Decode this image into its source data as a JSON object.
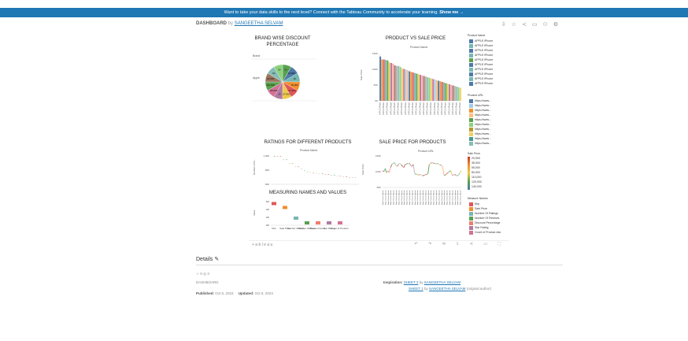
{
  "banner": {
    "text": "Want to take your data skills to the next level? Connect with the Tableau Community to accelerate your learning.",
    "link": "Show me →"
  },
  "header": {
    "title": "DASHBOARD",
    "by": "by",
    "author": "SANGEETHA SELVAM"
  },
  "header_icons": [
    "download-icon",
    "star-icon",
    "share-icon",
    "comment-icon",
    "user-icon",
    "settings-icon"
  ],
  "charts": {
    "pie_title": "BRAND WISE DISCOUNT PERCENTAGE",
    "pie_brand_label": "Brand",
    "pie_brand": "Apple",
    "pie_labels": [
      "26",
      "26,699",
      "26",
      "35,000",
      "117,900",
      "107,900",
      "14",
      "89,900",
      "110,900",
      "96,900",
      "60",
      "54"
    ],
    "bar_title": "PRODUCT VS SALE PRICE",
    "bar_header": "Product Name",
    "bar_ylabel": "Sale Price",
    "bar_ticks": [
      "150K",
      "100K",
      "50K",
      "0K"
    ],
    "rating_title": "RATINGS FOR DIFFERENT PRODUCTS",
    "rating_header": "Product Name",
    "rating_ylabel": "Number Of R...",
    "rating_ticks": [
      "1,000",
      "800",
      "600"
    ],
    "sale_title": "SALE PRICE FOR PRODUCTS",
    "sale_header": "Product URL",
    "sale_ylabel": "Sale Price",
    "sale_ticks": [
      "150K",
      "100K",
      "50K"
    ],
    "measure_title": "MEASURING NAMES AND VALUES",
    "measure_ylabel": "Value",
    "measure_ticks": [
      "6M",
      "4M",
      "2M",
      "0M"
    ],
    "measure_cats": [
      "Mrp",
      "Sale Price",
      "Number Of Rati..",
      "Number Of Revi..",
      "Discount Perce..",
      "Star Rating",
      "Count of Product.."
    ]
  },
  "legends": {
    "product_name_title": "Product Name",
    "product_names": [
      "APPLE iPhone",
      "APPLE iPhone",
      "APPLE iPhone",
      "APPLE iPhone",
      "APPLE iPhone",
      "APPLE iPhone",
      "APPLE iPhone",
      "APPLE iPhone",
      "APPLE iPhone",
      "APPLE iPhone"
    ],
    "product_url_title": "Product URL",
    "product_urls": [
      "https://www...",
      "https://www...",
      "https://www...",
      "https://www...",
      "https://www...",
      "https://www...",
      "https://www...",
      "https://www...",
      "https://www...",
      "https://www..."
    ],
    "sale_price_title": "Sale Price",
    "sale_prices": [
      "29,999",
      "35,000",
      "55,000",
      "80,000",
      "110,000",
      "120,000",
      "140,000"
    ],
    "measure_title": "Measure Names",
    "measures": [
      "Mrp",
      "Sale Price",
      "Number Of Ratings",
      "Number Of Reviews",
      "Discount Percentage",
      "Star Rating",
      "Count of Product.xlsx"
    ]
  },
  "colors": {
    "banner": "#1f77b4",
    "link": "#1f77b4"
  },
  "viz_toolbar": {
    "brand": "+ a b l e a u"
  },
  "details": {
    "heading": "Details",
    "favorites": "0",
    "views": "3",
    "type": "DASHBOARD",
    "published_label": "Published:",
    "published": "Oct 6, 2023",
    "updated_label": "Updated:",
    "updated": "Oct 6, 2023",
    "inspiration_label": "Inspiration:",
    "insp1_sheet": "SHEET 2",
    "insp_by": "by",
    "insp1_author": "SANGEETHA SELVAM",
    "insp2_sheet": "SHEET 1",
    "insp2_author": "SANGEETHA SELVAM",
    "insp2_note": "(original author)"
  }
}
